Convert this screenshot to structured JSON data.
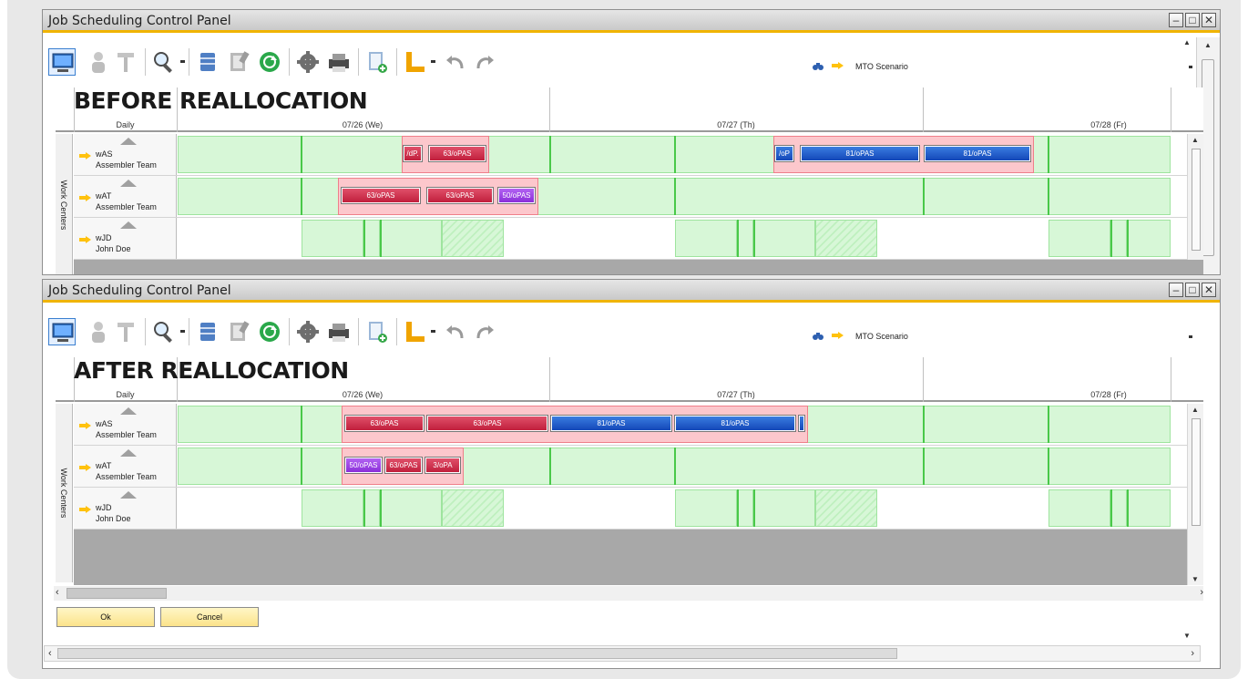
{
  "colors": {
    "accent_bar": "#f0b400",
    "calendar_fill": "#d7f7d7",
    "job_red": "#c11f3c",
    "job_blue": "#1347b8",
    "job_purple": "#8a2fd9",
    "button_fill": "#fbe38a"
  },
  "window_title": "Job Scheduling Control Panel",
  "toolbar": {
    "icons": [
      "monitor-icon",
      "resource-person-icon",
      "tools-icon",
      "magnifier-icon",
      "database-icon",
      "clipboard-icon",
      "refresh-icon",
      "gear-icon",
      "printer-icon",
      "document-add-icon",
      "ruler-icon",
      "undo-icon",
      "redo-icon"
    ],
    "scenario_label": "MTO Scenario"
  },
  "gantt": {
    "scale": "Daily",
    "dates": [
      "07/26 (We)",
      "07/27 (Th)",
      "07/28 (Fr)"
    ],
    "work_centers_label": "Work Centers",
    "rows": [
      {
        "code": "wAS",
        "name": "Assembler Team"
      },
      {
        "code": "wAT",
        "name": "Assembler Team"
      },
      {
        "code": "wJD",
        "name": "John Doe"
      }
    ]
  },
  "before": {
    "overlay": "BEFORE REALLOCATION",
    "row_wAS_bars": [
      "/dP.",
      "63/oPAS",
      "/oP",
      "81/oPAS",
      "81/oPAS"
    ],
    "row_wAT_bars": [
      "63/oPAS",
      "63/oPAS",
      "50/oPAS"
    ]
  },
  "after": {
    "overlay": "AFTER REALLOCATION",
    "row_wAS_bars": [
      "63/oPAS",
      "63/oPAS",
      "81/oPAS",
      "81/oPAS"
    ],
    "row_wAT_bars": [
      "50/oPAS",
      "63/oPAS",
      "3/oPA"
    ]
  },
  "buttons": {
    "ok": "Ok",
    "cancel": "Cancel"
  }
}
